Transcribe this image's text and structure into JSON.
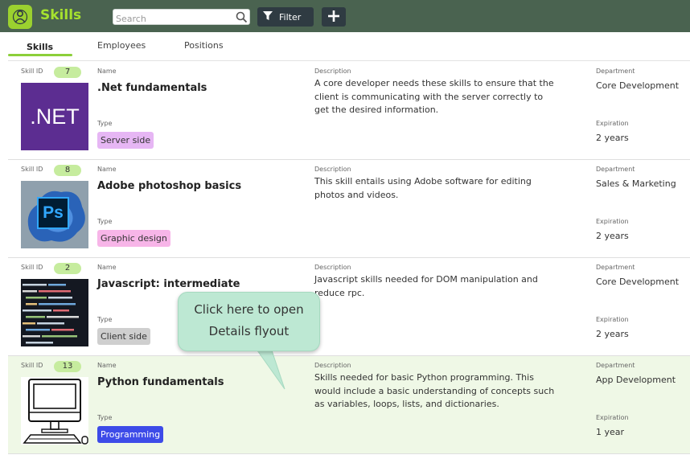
{
  "header": {
    "title": "Skills",
    "search_placeholder": "Search",
    "filter_label": "Filter"
  },
  "tabs": [
    {
      "label": "Skills",
      "active": true
    },
    {
      "label": "Employees",
      "active": false
    },
    {
      "label": "Positions",
      "active": false
    }
  ],
  "labels": {
    "skill_id": "Skill ID",
    "name": "Name",
    "type": "Type",
    "description": "Description",
    "department": "Department",
    "expiration": "Expiration"
  },
  "skills": [
    {
      "id": "7",
      "name": ".Net fundamentals",
      "type": "Server side",
      "type_color": "#e6b6f4",
      "description": "A core developer needs these skills to ensure that the client is communicating with the server correctly to get the desired information.",
      "department": "Core Development",
      "expiration": "2 years",
      "thumb_text": ".NET"
    },
    {
      "id": "8",
      "name": "Adobe photoshop basics",
      "type": "Graphic design",
      "type_color": "#f7b5e8",
      "description": "This skill entails using Adobe software for editing photos and videos.",
      "department": "Sales & Marketing",
      "expiration": "2 years",
      "thumb_text": "Ps"
    },
    {
      "id": "2",
      "name": "Javascript: intermediate",
      "type": "Client side",
      "type_color": "#cfcfcf",
      "description": "Javascript skills needed for DOM manipulation and reduce rpc.",
      "department": "Core Development",
      "expiration": "2 years"
    },
    {
      "id": "13",
      "name": "Python fundamentals",
      "type": "Programming",
      "type_color": "#3d4be8",
      "description": "Skills needed for basic Python programming. This would include a basic understanding of concepts such as variables, loops, lists, and dictionaries.",
      "department": "App Development",
      "expiration": "1 year"
    }
  ],
  "tooltip": {
    "line1": "Click here to open",
    "line2": "Details flyout"
  },
  "colors": {
    "header_bg": "#4a6350",
    "accent": "#a6e22e",
    "selected_row": "#eff8e6"
  }
}
